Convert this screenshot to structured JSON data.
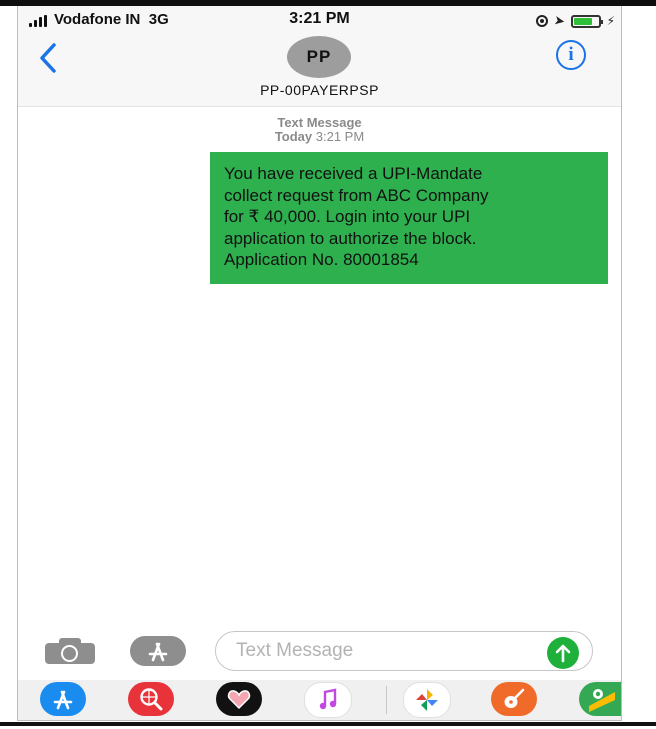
{
  "status_bar": {
    "carrier": "Vodafone IN",
    "network": "3G",
    "time": "3:21 PM",
    "battery_level": 0.8,
    "icons": [
      "signal-bars-icon",
      "orientation-lock-icon",
      "location-arrow-icon",
      "battery-icon",
      "charging-bolt-icon"
    ]
  },
  "header": {
    "back_icon": "chevron-left-icon",
    "avatar_initials": "PP",
    "contact_name": "PP-00PAYERPSP",
    "info_icon": "info-icon",
    "info_glyph": "i"
  },
  "conversation": {
    "meta_label": "Text Message",
    "meta_day": "Today",
    "meta_time": "3:21 PM",
    "messages": [
      {
        "lines": [
          "You have received a UPI-Mandate",
          "collect request from ABC Company",
          "for ₹ 40,000. Login into your UPI",
          "application to authorize the block.",
          "Application No. 80001854"
        ]
      }
    ],
    "bubble_color": "#2eb04f"
  },
  "compose": {
    "camera_icon": "camera-icon",
    "apps_icon": "app-store-icon",
    "placeholder": "Text Message",
    "value": "",
    "send_icon": "arrow-up-icon"
  },
  "app_drawer": {
    "apps": [
      {
        "icon": "app-store-icon",
        "color": "#1a8cf0"
      },
      {
        "icon": "web-search-icon",
        "color": "#e8333a"
      },
      {
        "icon": "digital-touch-heart-icon",
        "color": "#111111"
      },
      {
        "icon": "music-note-icon",
        "color": "#ffffff"
      },
      {
        "icon": "photos-pinwheel-icon",
        "color": "#ffffff"
      },
      {
        "icon": "garageband-guitar-icon",
        "color": "#f06a2a"
      },
      {
        "icon": "maps-icon",
        "color": "#34a853"
      }
    ]
  }
}
